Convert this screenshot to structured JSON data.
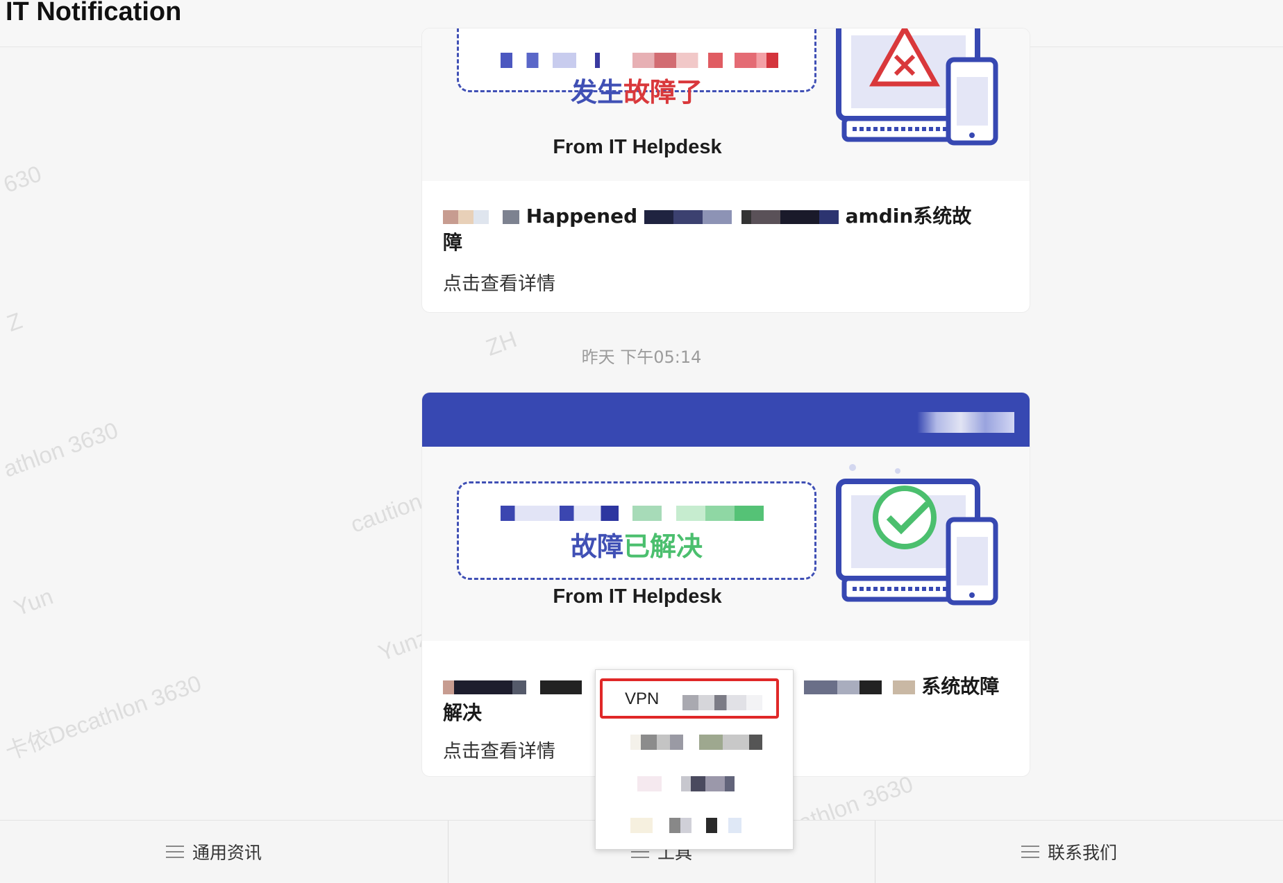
{
  "header": {
    "title": "IT Notification"
  },
  "watermarks": [
    "630",
    "athlon 3630",
    "Z",
    "Yun",
    "卡依Decathlon 3630",
    "Yunz",
    "athlon 3630",
    "ZH",
    "caution",
    "Yunz"
  ],
  "messages": [
    {
      "status_part1": "发生",
      "status_part2": "故障了",
      "from": "From IT Helpdesk",
      "title_parts": [
        "Happened",
        "amdin系统故",
        "障"
      ],
      "link": "点击查看详情",
      "icon": "monitor-error-icon"
    },
    {
      "status_part1": "故障",
      "status_part2": "已解决",
      "from": "From IT Helpdesk",
      "title_parts": [
        "系统故障",
        "解决"
      ],
      "link": "点击查看详情",
      "icon": "monitor-success-icon"
    }
  ],
  "timestamp": "昨天 下午05:14",
  "popup_menu": {
    "items": [
      {
        "label": "VPN",
        "highlighted": true
      },
      {
        "label": ""
      },
      {
        "label": ""
      },
      {
        "label": ""
      }
    ]
  },
  "tabs": [
    {
      "label": "通用资讯",
      "icon": "menu-icon"
    },
    {
      "label": "工具",
      "icon": "menu-icon"
    },
    {
      "label": "联系我们",
      "icon": "menu-icon"
    }
  ],
  "colors": {
    "brand_blue": "#3748b2",
    "error_red": "#d9383b",
    "success_green": "#4bbf6e",
    "highlight_red": "#e02828"
  }
}
